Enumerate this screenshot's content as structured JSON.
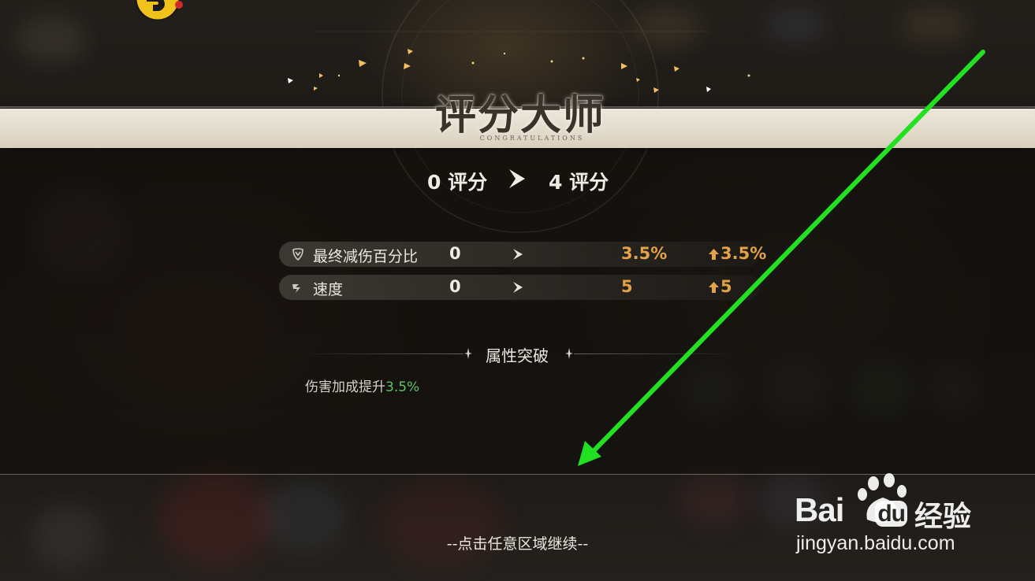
{
  "title": {
    "main": "评分大师",
    "sub": "CONGRATULATIONS"
  },
  "score": {
    "from": "0 评分",
    "to": "4 评分"
  },
  "stats": [
    {
      "name": "最终减伤百分比",
      "icon": "shield-break-icon",
      "old": "0",
      "new": "3.5%",
      "increase": "3.5%"
    },
    {
      "name": "速度",
      "icon": "speed-icon",
      "old": "0",
      "new": "5",
      "increase": "5"
    }
  ],
  "breakthrough": {
    "title": "属性突破",
    "text": "伤害加成提升",
    "value": "3.5%"
  },
  "continue_hint": "--点击任意区域继续--",
  "watermark": {
    "brand_latin": "Bai",
    "brand_du": "du",
    "brand_cn": "经验",
    "url": "jingyan.baidu.com"
  },
  "colors": {
    "banner": "#e3dccd",
    "stat_value": "#e3a248",
    "highlight_green": "#5fc36a",
    "annotation_arrow": "#22e022"
  }
}
